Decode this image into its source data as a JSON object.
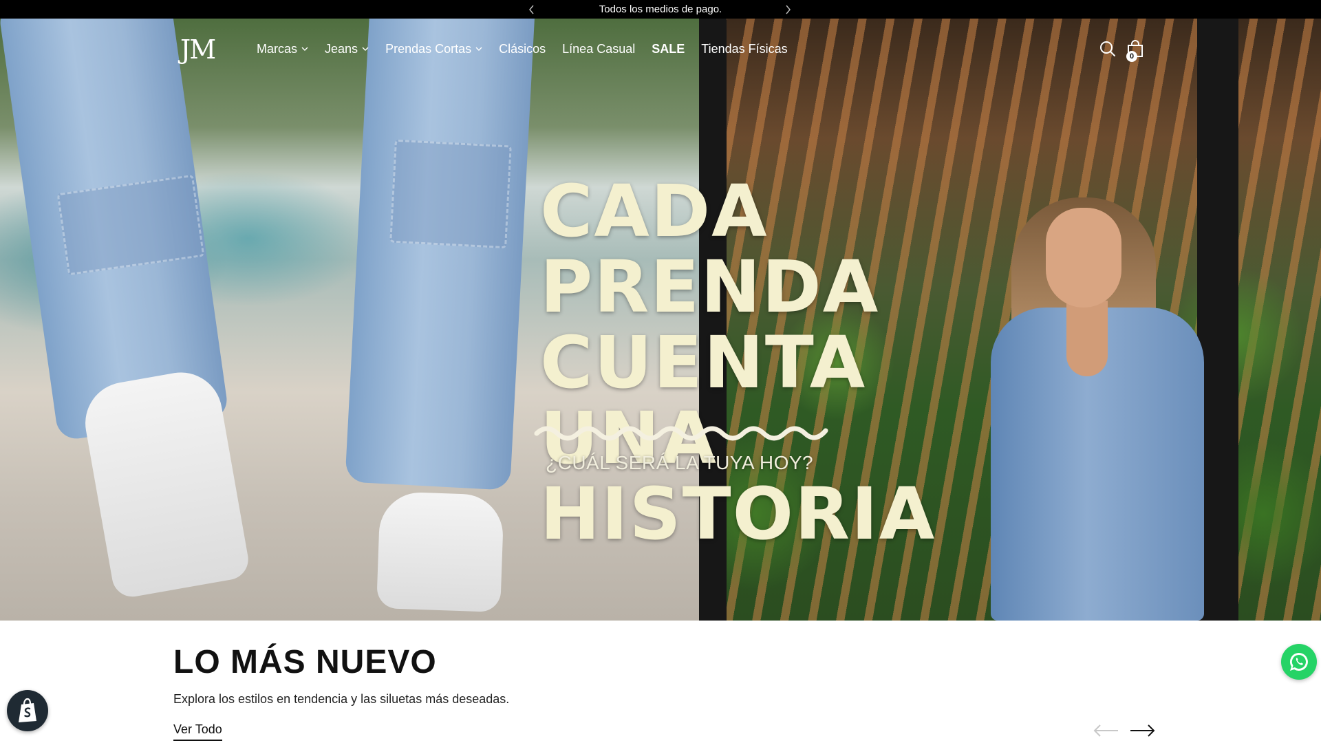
{
  "announcement": {
    "text": "Todos los medios de pago."
  },
  "header": {
    "logo_text": "JM",
    "nav": [
      {
        "label": "Marcas",
        "has_dropdown": true
      },
      {
        "label": "Jeans",
        "has_dropdown": true
      },
      {
        "label": "Prendas Cortas",
        "has_dropdown": true
      },
      {
        "label": "Clásicos",
        "has_dropdown": false
      },
      {
        "label": "Línea Casual",
        "has_dropdown": false
      },
      {
        "label": "SALE",
        "has_dropdown": false
      },
      {
        "label": "Tiendas Físicas",
        "has_dropdown": false
      }
    ],
    "cart_count": "0"
  },
  "hero": {
    "headline_line1": "CADA PRENDA",
    "headline_line2": "CUENTA UNA",
    "headline_line3": "HISTORIA",
    "subheadline": "¿CUÁL SERÁ LA TUYA HOY?"
  },
  "new_section": {
    "title": "LO MÁS NUEVO",
    "description": "Explora los estilos en tendencia y las siluetas más deseadas.",
    "view_all": "Ver Todo"
  },
  "colors": {
    "announcement_bg": "#000000",
    "headline": "#f4f0cf",
    "whatsapp": "#25d366",
    "shopify_badge": "#1f2a33"
  },
  "icons": {
    "search": "search-icon",
    "cart": "shopping-bag-icon",
    "whatsapp": "whatsapp-icon",
    "shopify": "shopify-icon"
  }
}
